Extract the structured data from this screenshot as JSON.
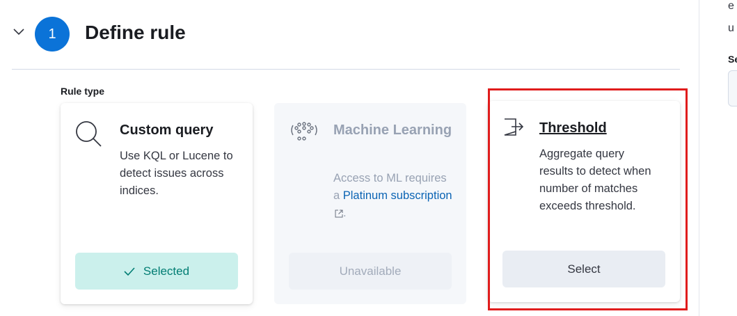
{
  "step": {
    "number": "1",
    "title": "Define rule"
  },
  "rule_type_label": "Rule type",
  "cards": {
    "custom_query": {
      "icon": "magnifier-icon",
      "title": "Custom query",
      "description": "Use KQL or Lucene to detect issues across indices.",
      "button_label": "Selected",
      "button_icon": "checkmark-icon",
      "state": "selected"
    },
    "machine_learning": {
      "icon": "ml-nodes-icon",
      "title": "Machine Learning",
      "description_prefix": "Access to ML requires a ",
      "link_text": "Platinum subscription",
      "description_suffix": ".",
      "button_label": "Unavailable",
      "state": "disabled"
    },
    "threshold": {
      "icon": "threshold-icon",
      "title": "Threshold",
      "description": "Aggregate query results to detect when number of matches exceeds threshold.",
      "button_label": "Select",
      "state": "available"
    }
  },
  "right_panel": {
    "line1": "e",
    "line2": "u",
    "label": "Se"
  },
  "colors": {
    "step_circle": "#0b73d8",
    "selected_bg": "#cbf0ec",
    "selected_text": "#017d73",
    "link": "#0b64b4",
    "highlight": "#e01c1c"
  }
}
